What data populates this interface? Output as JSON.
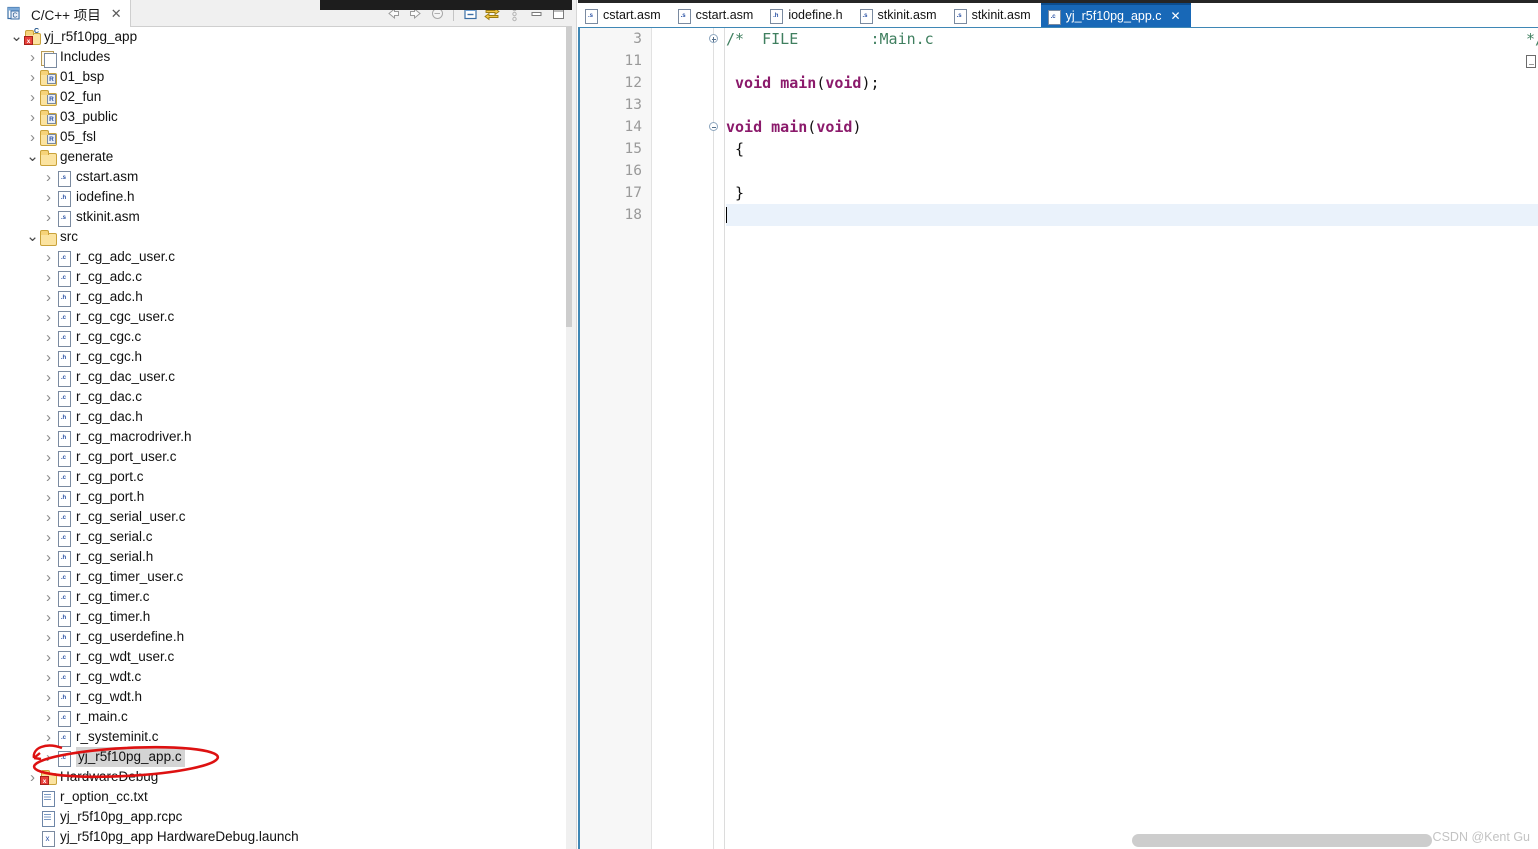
{
  "sidebar": {
    "tab": {
      "label": "C/C++ 项目",
      "icon": "cproject-icon",
      "close": "✕"
    },
    "toolbar": [
      {
        "name": "back-icon",
        "glyph": "⇦"
      },
      {
        "name": "forward-icon",
        "glyph": "⇨"
      },
      {
        "name": "home-icon",
        "glyph": "⊙"
      },
      {
        "name": "collapse-all-icon",
        "glyph": "⊟"
      },
      {
        "name": "link-with-editor-icon",
        "glyph": "⇄"
      },
      {
        "name": "view-menu-icon",
        "glyph": "⋮"
      },
      {
        "name": "minimize-icon",
        "glyph": "▁"
      },
      {
        "name": "maximize-icon",
        "glyph": "□"
      }
    ],
    "tree": [
      {
        "label": "yj_r5f10pg_app",
        "indent": 0,
        "twisty": "open",
        "icon": "project",
        "ext": "C"
      },
      {
        "label": "Includes",
        "indent": 1,
        "twisty": "closed",
        "icon": "includes",
        "ext": "h"
      },
      {
        "label": "01_bsp",
        "indent": 1,
        "twisty": "closed",
        "icon": "srcfolder",
        "ext": "R"
      },
      {
        "label": "02_fun",
        "indent": 1,
        "twisty": "closed",
        "icon": "srcfolder",
        "ext": "R"
      },
      {
        "label": "03_public",
        "indent": 1,
        "twisty": "closed",
        "icon": "srcfolder",
        "ext": "R"
      },
      {
        "label": "05_fsl",
        "indent": 1,
        "twisty": "closed",
        "icon": "srcfolder",
        "ext": "R"
      },
      {
        "label": "generate",
        "indent": 1,
        "twisty": "open",
        "icon": "folder",
        "ext": ""
      },
      {
        "label": "cstart.asm",
        "indent": 2,
        "twisty": "closed",
        "icon": "file",
        "ext": ".s"
      },
      {
        "label": "iodefine.h",
        "indent": 2,
        "twisty": "closed",
        "icon": "file",
        "ext": ".h"
      },
      {
        "label": "stkinit.asm",
        "indent": 2,
        "twisty": "closed",
        "icon": "file",
        "ext": ".s"
      },
      {
        "label": "src",
        "indent": 1,
        "twisty": "open",
        "icon": "folder",
        "ext": ""
      },
      {
        "label": "r_cg_adc_user.c",
        "indent": 2,
        "twisty": "closed",
        "icon": "file",
        "ext": ".c"
      },
      {
        "label": "r_cg_adc.c",
        "indent": 2,
        "twisty": "closed",
        "icon": "file",
        "ext": ".c"
      },
      {
        "label": "r_cg_adc.h",
        "indent": 2,
        "twisty": "closed",
        "icon": "file",
        "ext": ".h"
      },
      {
        "label": "r_cg_cgc_user.c",
        "indent": 2,
        "twisty": "closed",
        "icon": "file",
        "ext": ".c"
      },
      {
        "label": "r_cg_cgc.c",
        "indent": 2,
        "twisty": "closed",
        "icon": "file",
        "ext": ".c"
      },
      {
        "label": "r_cg_cgc.h",
        "indent": 2,
        "twisty": "closed",
        "icon": "file",
        "ext": ".h"
      },
      {
        "label": "r_cg_dac_user.c",
        "indent": 2,
        "twisty": "closed",
        "icon": "file",
        "ext": ".c"
      },
      {
        "label": "r_cg_dac.c",
        "indent": 2,
        "twisty": "closed",
        "icon": "file",
        "ext": ".c"
      },
      {
        "label": "r_cg_dac.h",
        "indent": 2,
        "twisty": "closed",
        "icon": "file",
        "ext": ".h"
      },
      {
        "label": "r_cg_macrodriver.h",
        "indent": 2,
        "twisty": "closed",
        "icon": "file",
        "ext": ".h"
      },
      {
        "label": "r_cg_port_user.c",
        "indent": 2,
        "twisty": "closed",
        "icon": "file",
        "ext": ".c"
      },
      {
        "label": "r_cg_port.c",
        "indent": 2,
        "twisty": "closed",
        "icon": "file",
        "ext": ".c"
      },
      {
        "label": "r_cg_port.h",
        "indent": 2,
        "twisty": "closed",
        "icon": "file",
        "ext": ".h"
      },
      {
        "label": "r_cg_serial_user.c",
        "indent": 2,
        "twisty": "closed",
        "icon": "file",
        "ext": ".c"
      },
      {
        "label": "r_cg_serial.c",
        "indent": 2,
        "twisty": "closed",
        "icon": "file",
        "ext": ".c"
      },
      {
        "label": "r_cg_serial.h",
        "indent": 2,
        "twisty": "closed",
        "icon": "file",
        "ext": ".h"
      },
      {
        "label": "r_cg_timer_user.c",
        "indent": 2,
        "twisty": "closed",
        "icon": "file",
        "ext": ".c"
      },
      {
        "label": "r_cg_timer.c",
        "indent": 2,
        "twisty": "closed",
        "icon": "file",
        "ext": ".c"
      },
      {
        "label": "r_cg_timer.h",
        "indent": 2,
        "twisty": "closed",
        "icon": "file",
        "ext": ".h"
      },
      {
        "label": "r_cg_userdefine.h",
        "indent": 2,
        "twisty": "closed",
        "icon": "file",
        "ext": ".h"
      },
      {
        "label": "r_cg_wdt_user.c",
        "indent": 2,
        "twisty": "closed",
        "icon": "file",
        "ext": ".c"
      },
      {
        "label": "r_cg_wdt.c",
        "indent": 2,
        "twisty": "closed",
        "icon": "file",
        "ext": ".c"
      },
      {
        "label": "r_cg_wdt.h",
        "indent": 2,
        "twisty": "closed",
        "icon": "file",
        "ext": ".h"
      },
      {
        "label": "r_main.c",
        "indent": 2,
        "twisty": "closed",
        "icon": "file",
        "ext": ".c"
      },
      {
        "label": "r_systeminit.c",
        "indent": 2,
        "twisty": "closed",
        "icon": "file",
        "ext": ".c"
      },
      {
        "label": "yj_r5f10pg_app.c",
        "indent": 2,
        "twisty": "closed",
        "icon": "file",
        "ext": ".c",
        "selected": true
      },
      {
        "label": "HardwareDebug",
        "indent": 1,
        "twisty": "closed",
        "icon": "hwdebug",
        "ext": ""
      },
      {
        "label": "r_option_cc.txt",
        "indent": 1,
        "twisty": "none",
        "icon": "txtfile",
        "ext": ""
      },
      {
        "label": "yj_r5f10pg_app.rcpc",
        "indent": 1,
        "twisty": "none",
        "icon": "txtfile",
        "ext": ""
      },
      {
        "label": "yj_r5f10pg_app HardwareDebug.launch",
        "indent": 1,
        "twisty": "none",
        "icon": "launch",
        "ext": "x"
      }
    ]
  },
  "editor": {
    "tabs": [
      {
        "label": "cstart.asm",
        "ext": ".s",
        "active": false
      },
      {
        "label": "cstart.asm",
        "ext": ".s",
        "active": false
      },
      {
        "label": "iodefine.h",
        "ext": ".h",
        "active": false
      },
      {
        "label": "stkinit.asm",
        "ext": ".s",
        "active": false
      },
      {
        "label": "stkinit.asm",
        "ext": ".s",
        "active": false
      },
      {
        "label": "yj_r5f10pg_app.c",
        "ext": ".c",
        "active": true,
        "close": "✕"
      }
    ],
    "line_numbers": [
      "3",
      "11",
      "12",
      "13",
      "14",
      "15",
      "16",
      "17",
      "18"
    ],
    "fold_markers": [
      {
        "line_index": 0,
        "type": "plus"
      },
      {
        "line_index": 4,
        "type": "minus"
      }
    ],
    "lines": [
      {
        "segments": [
          {
            "t": "/*  FILE        :Main.c",
            "c": "cm"
          }
        ]
      },
      {
        "segments": []
      },
      {
        "segments": [
          {
            "t": " ",
            "c": "pl"
          },
          {
            "t": "void",
            "c": "kw"
          },
          {
            "t": " ",
            "c": "pl"
          },
          {
            "t": "main",
            "c": "kw"
          },
          {
            "t": "(",
            "c": "pl"
          },
          {
            "t": "void",
            "c": "kw"
          },
          {
            "t": ");",
            "c": "pl"
          }
        ]
      },
      {
        "segments": []
      },
      {
        "segments": [
          {
            "t": "",
            "c": "pl"
          },
          {
            "t": "void",
            "c": "kw"
          },
          {
            "t": " ",
            "c": "pl"
          },
          {
            "t": "main",
            "c": "kw"
          },
          {
            "t": "(",
            "c": "pl"
          },
          {
            "t": "void",
            "c": "kw"
          },
          {
            "t": ")",
            "c": "pl"
          }
        ]
      },
      {
        "segments": [
          {
            "t": " {",
            "c": "pl"
          }
        ]
      },
      {
        "segments": []
      },
      {
        "segments": [
          {
            "t": " }",
            "c": "pl"
          }
        ]
      },
      {
        "segments": [],
        "current": true,
        "caret": true
      }
    ],
    "line3_tail": "*/",
    "line3_tail_glyph": "unprintable-box"
  },
  "annotation": {
    "shape": "red-ellipse",
    "color": "#dd1111",
    "target": "yj_r5f10pg_app.c"
  },
  "watermark": "CSDN @Kent Gu",
  "colors": {
    "active_tab_bg": "#1868b7",
    "tabbar_bg": "#262626",
    "current_line": "#eaf2fb",
    "keyword": "#8b1a6b",
    "comment": "#3f7f5f",
    "selection": "#d4d4d4",
    "annotation": "#dd1111"
  }
}
